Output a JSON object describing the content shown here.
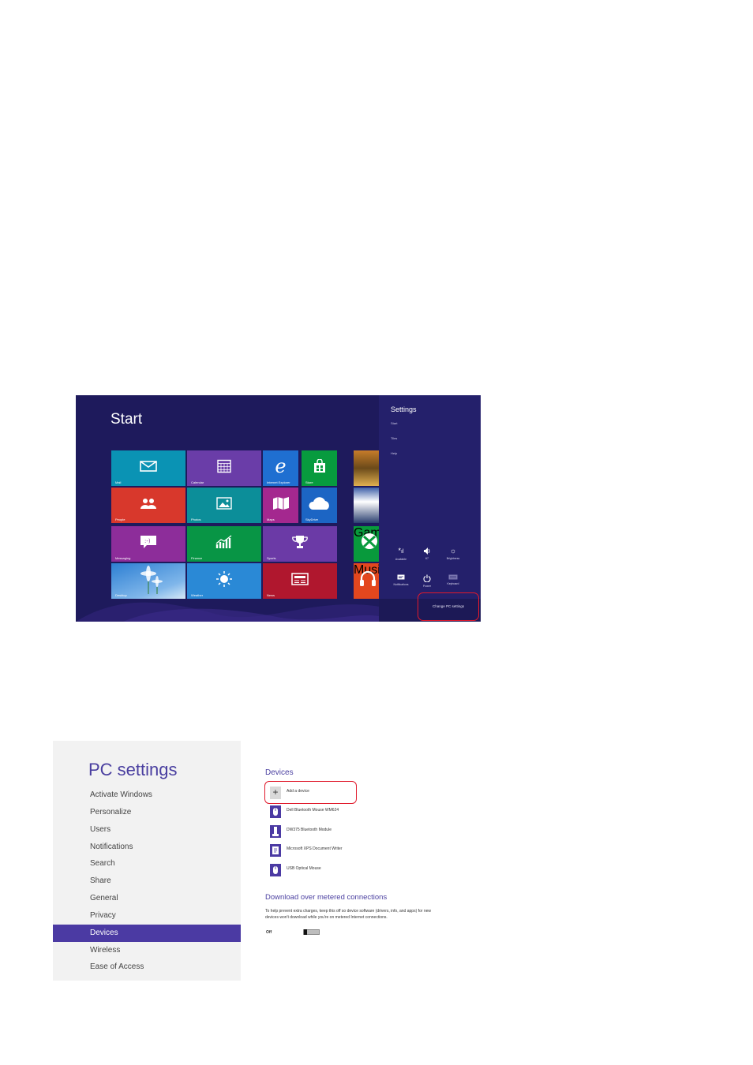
{
  "start_screen": {
    "title": "Start",
    "tiles": [
      {
        "label": "Mail",
        "color": "#0a93b4",
        "icon": "mail-icon"
      },
      {
        "label": "Calendar",
        "color": "#6a3da8",
        "icon": "calendar-icon"
      },
      {
        "label": "Internet Explorer",
        "color": "#1f6fd1",
        "icon": "internet-explorer-icon"
      },
      {
        "label": "Store",
        "color": "#079b3e",
        "icon": "store-icon"
      },
      {
        "label": "People",
        "color": "#d8382c",
        "icon": "people-icon"
      },
      {
        "label": "Photos",
        "color": "#0c8e99",
        "icon": "photos-icon"
      },
      {
        "label": "Maps",
        "color": "#a4288f",
        "icon": "maps-icon"
      },
      {
        "label": "SkyDrive",
        "color": "#1c65c4",
        "icon": "skydrive-icon"
      },
      {
        "label": "Messaging",
        "color": "#8d2d9a",
        "icon": "messaging-icon"
      },
      {
        "label": "Finance",
        "color": "#089545",
        "icon": "finance-icon"
      },
      {
        "label": "Sports",
        "color": "#6b3aa6",
        "icon": "trophy-icon"
      },
      {
        "label": "Desktop",
        "color": "#2d7fd3",
        "icon": "desktop-icon"
      },
      {
        "label": "Weather",
        "color": "#2a89d6",
        "icon": "sun-icon"
      },
      {
        "label": "News",
        "color": "#b0172e",
        "icon": "news-icon"
      },
      {
        "label": "Games",
        "color": "#089a3c",
        "icon": "xbox-icon"
      },
      {
        "label": "Music",
        "color": "#e3471e",
        "icon": "headphones-icon"
      }
    ]
  },
  "charm": {
    "title": "Settings",
    "items": [
      "Start",
      "Tiles",
      "Help"
    ],
    "quick": [
      {
        "label": "Available",
        "icon": "network-icon",
        "glyph": "📶"
      },
      {
        "label": "67",
        "icon": "volume-icon",
        "glyph": "🔊"
      },
      {
        "label": "Brightness",
        "icon": "brightness-icon",
        "glyph": "☼"
      },
      {
        "label": "Notifications",
        "icon": "notifications-icon",
        "glyph": "▭"
      },
      {
        "label": "Power",
        "icon": "power-icon",
        "glyph": "⏻"
      },
      {
        "label": "Keyboard",
        "icon": "keyboard-icon",
        "glyph": "▤"
      }
    ],
    "change_pc_settings": "Change PC settings"
  },
  "pc_settings": {
    "title": "PC settings",
    "nav": [
      "Activate Windows",
      "Personalize",
      "Users",
      "Notifications",
      "Search",
      "Share",
      "General",
      "Privacy",
      "Devices",
      "Wireless",
      "Ease of Access"
    ],
    "selected": "Devices",
    "devices_heading": "Devices",
    "devices": [
      {
        "name": "Add a device",
        "icon": "plus-icon"
      },
      {
        "name": "Dell Bluetooth Mouse WM624",
        "icon": "mouse-icon"
      },
      {
        "name": "DW375 Bluetooth Module",
        "icon": "usb-icon"
      },
      {
        "name": "Microsoft XPS Document Writer",
        "icon": "printer-icon"
      },
      {
        "name": "USB Optical Mouse",
        "icon": "mouse-icon"
      }
    ],
    "download_heading": "Download over metered connections",
    "download_desc": "To help prevent extra charges, keep this off so device software (drivers, info, and apps) for new devices won't download while you're on metered Internet connections.",
    "download_state": "Off"
  }
}
